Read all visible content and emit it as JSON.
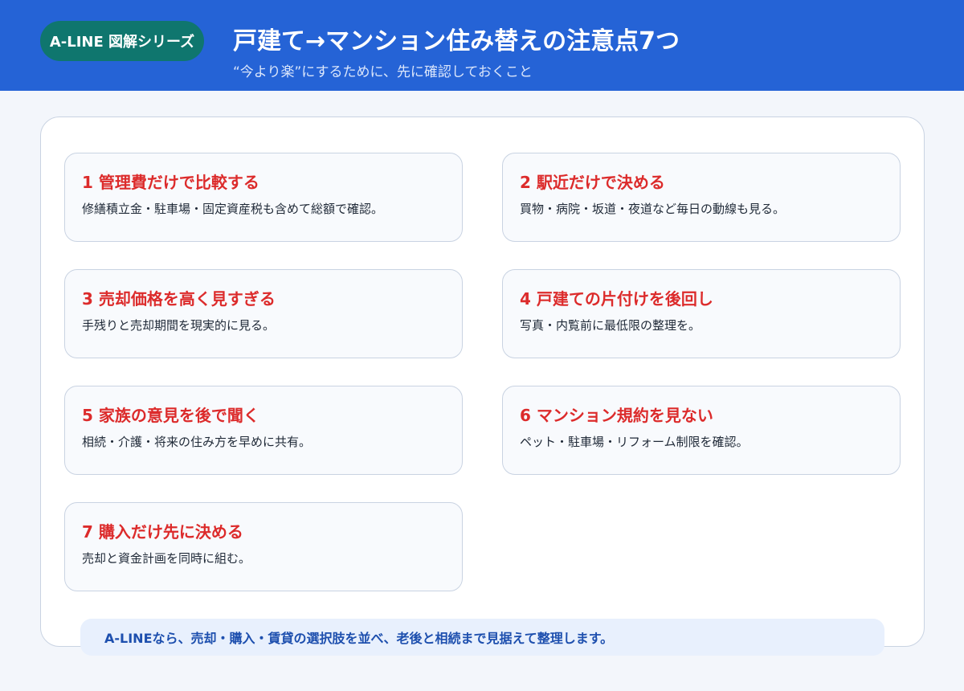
{
  "header": {
    "badge": "A-LINE 図解シリーズ",
    "title": "戸建て→マンション住み替えの注意点7つ",
    "subtitle": "“今より楽”にするために、先に確認しておくこと"
  },
  "cards": [
    {
      "title": "1 管理費だけで比較する",
      "desc": "修繕積立金・駐車場・固定資産税も含めて総額で確認。"
    },
    {
      "title": "2 駅近だけで決める",
      "desc": "買物・病院・坂道・夜道など毎日の動線も見る。"
    },
    {
      "title": "3 売却価格を高く見すぎる",
      "desc": "手残りと売却期間を現実的に見る。"
    },
    {
      "title": "4 戸建ての片付けを後回し",
      "desc": "写真・内覧前に最低限の整理を。"
    },
    {
      "title": "5 家族の意見を後で聞く",
      "desc": "相続・介護・将来の住み方を早めに共有。"
    },
    {
      "title": "6 マンション規約を見ない",
      "desc": "ペット・駐車場・リフォーム制限を確認。"
    },
    {
      "title": "7 購入だけ先に決める",
      "desc": "売却と資金計画を同時に組む。"
    }
  ],
  "footer": {
    "text": "A-LINEなら、売却・購入・賃貸の選択肢を並べ、老後と相続まで見据えて整理します。"
  },
  "colors": {
    "header_bg": "#2563d6",
    "badge_bg": "#0f766e",
    "card_title": "#dc2b2b",
    "footer_bg": "#e8f0fd",
    "footer_text": "#1d4fae"
  }
}
